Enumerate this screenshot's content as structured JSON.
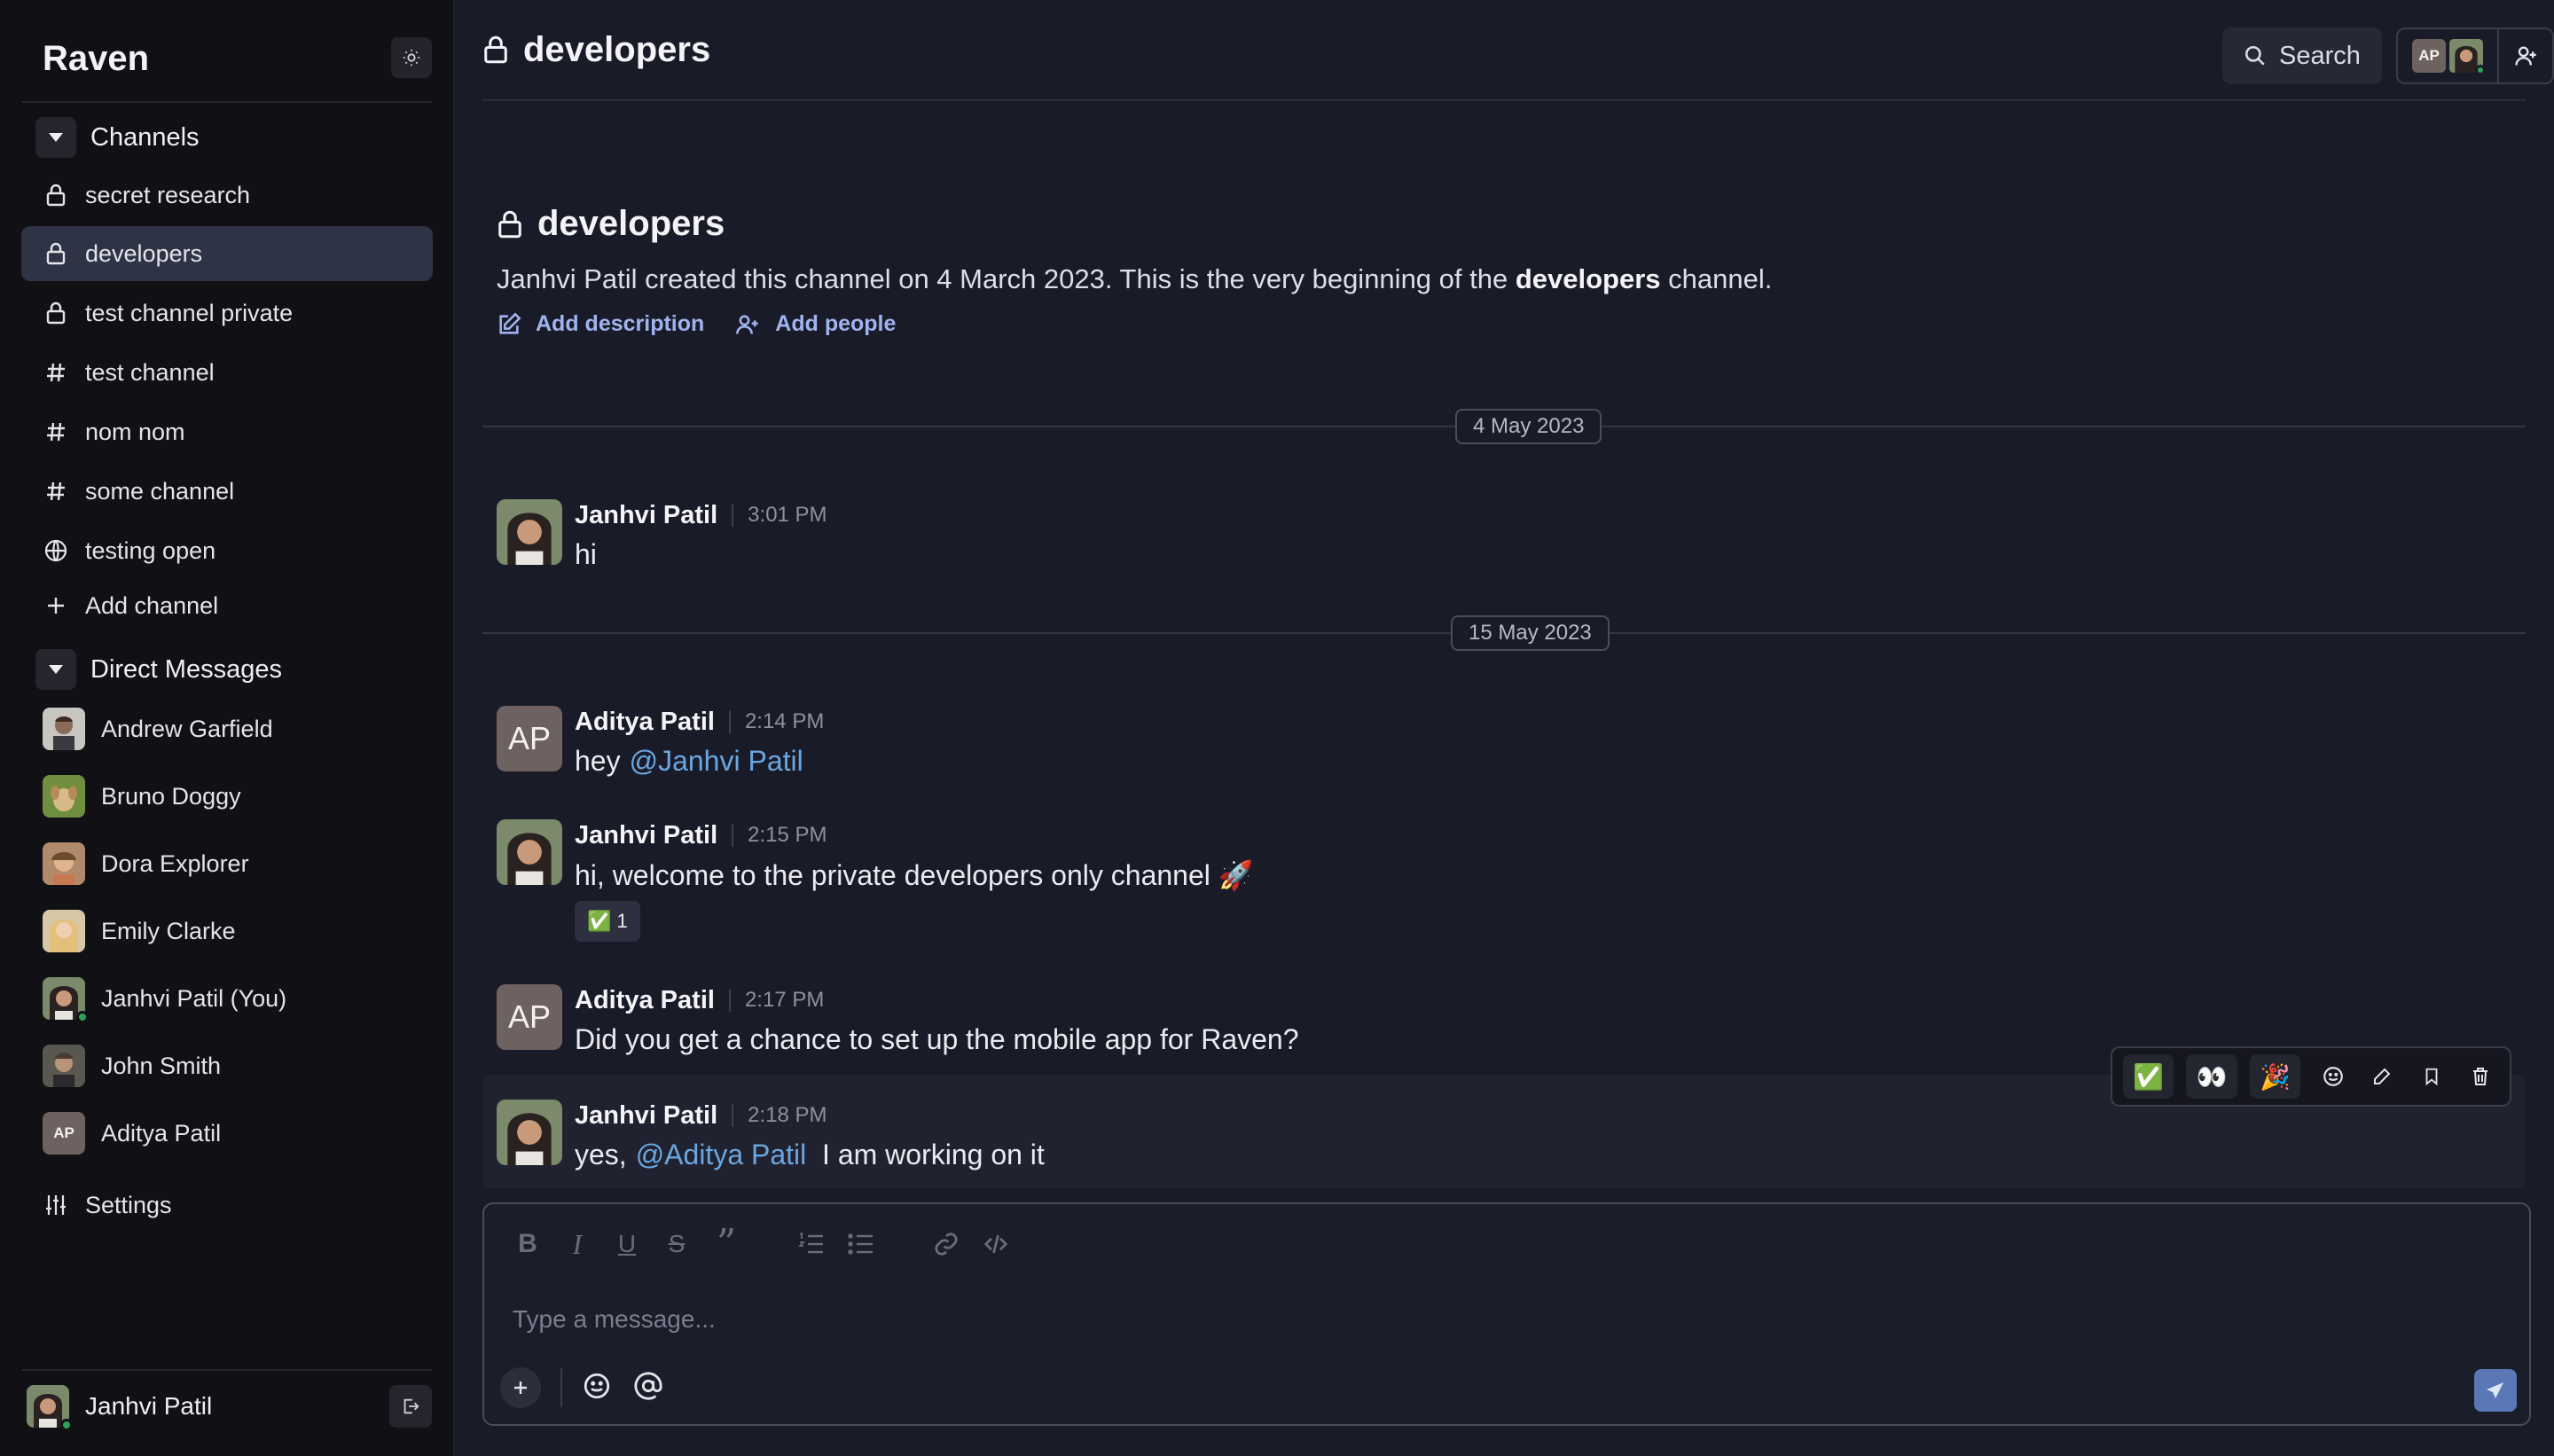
{
  "app": {
    "name": "Raven"
  },
  "sidebar": {
    "channels_label": "Channels",
    "channels": [
      {
        "label": "secret research",
        "icon": "lock-icon"
      },
      {
        "label": "developers",
        "icon": "lock-icon",
        "active": true
      },
      {
        "label": "test channel private",
        "icon": "lock-icon"
      },
      {
        "label": "test channel",
        "icon": "hash-icon"
      },
      {
        "label": "nom nom",
        "icon": "hash-icon"
      },
      {
        "label": "some channel",
        "icon": "hash-icon"
      },
      {
        "label": "testing open",
        "icon": "globe-icon"
      }
    ],
    "add_channel": "Add channel",
    "dm_label": "Direct Messages",
    "dms": [
      {
        "label": "Andrew Garfield"
      },
      {
        "label": "Bruno Doggy"
      },
      {
        "label": "Dora Explorer"
      },
      {
        "label": "Emily Clarke"
      },
      {
        "label": "Janhvi Patil (You)",
        "online": true
      },
      {
        "label": "John Smith"
      },
      {
        "label": "Aditya Patil",
        "initials": "AP"
      }
    ],
    "settings": "Settings",
    "current_user": "Janhvi Patil"
  },
  "header": {
    "channel": "developers",
    "search": "Search",
    "member_initials": "AP"
  },
  "intro": {
    "title": "developers",
    "desc_prefix": "Janhvi Patil created this channel on 4 March 2023. This is the very beginning of the",
    "desc_channel": "developers",
    "desc_suffix": "channel.",
    "add_description": "Add description",
    "add_people": "Add people"
  },
  "dates": [
    "4 May 2023",
    "15 May 2023"
  ],
  "messages": [
    {
      "author": "Janhvi Patil",
      "time": "3:01 PM",
      "text": "hi"
    },
    {
      "author": "Aditya Patil",
      "initials": "AP",
      "time": "2:14 PM",
      "text": "hey",
      "mention": "@Janhvi Patil"
    },
    {
      "author": "Janhvi Patil",
      "time": "2:15 PM",
      "text": "hi, welcome to the private developers only channel 🚀",
      "reaction": "✅",
      "reaction_count": "1"
    },
    {
      "author": "Aditya Patil",
      "initials": "AP",
      "time": "2:17 PM",
      "text": "Did you get a chance to set up the mobile app for Raven?"
    },
    {
      "author": "Janhvi Patil",
      "time": "2:18 PM",
      "text_before": "yes,",
      "mention": "@Aditya Patil",
      "text_after": "I am working on it"
    }
  ],
  "hover_toolbar": {
    "emojis": [
      "✅",
      "👀",
      "🎉"
    ]
  },
  "composer": {
    "placeholder": "Type a message..."
  },
  "colors": {
    "accent": "#9fb4ee",
    "mention": "#6aa7e0",
    "active_item": "#2e3446",
    "send": "#5a78b6"
  }
}
